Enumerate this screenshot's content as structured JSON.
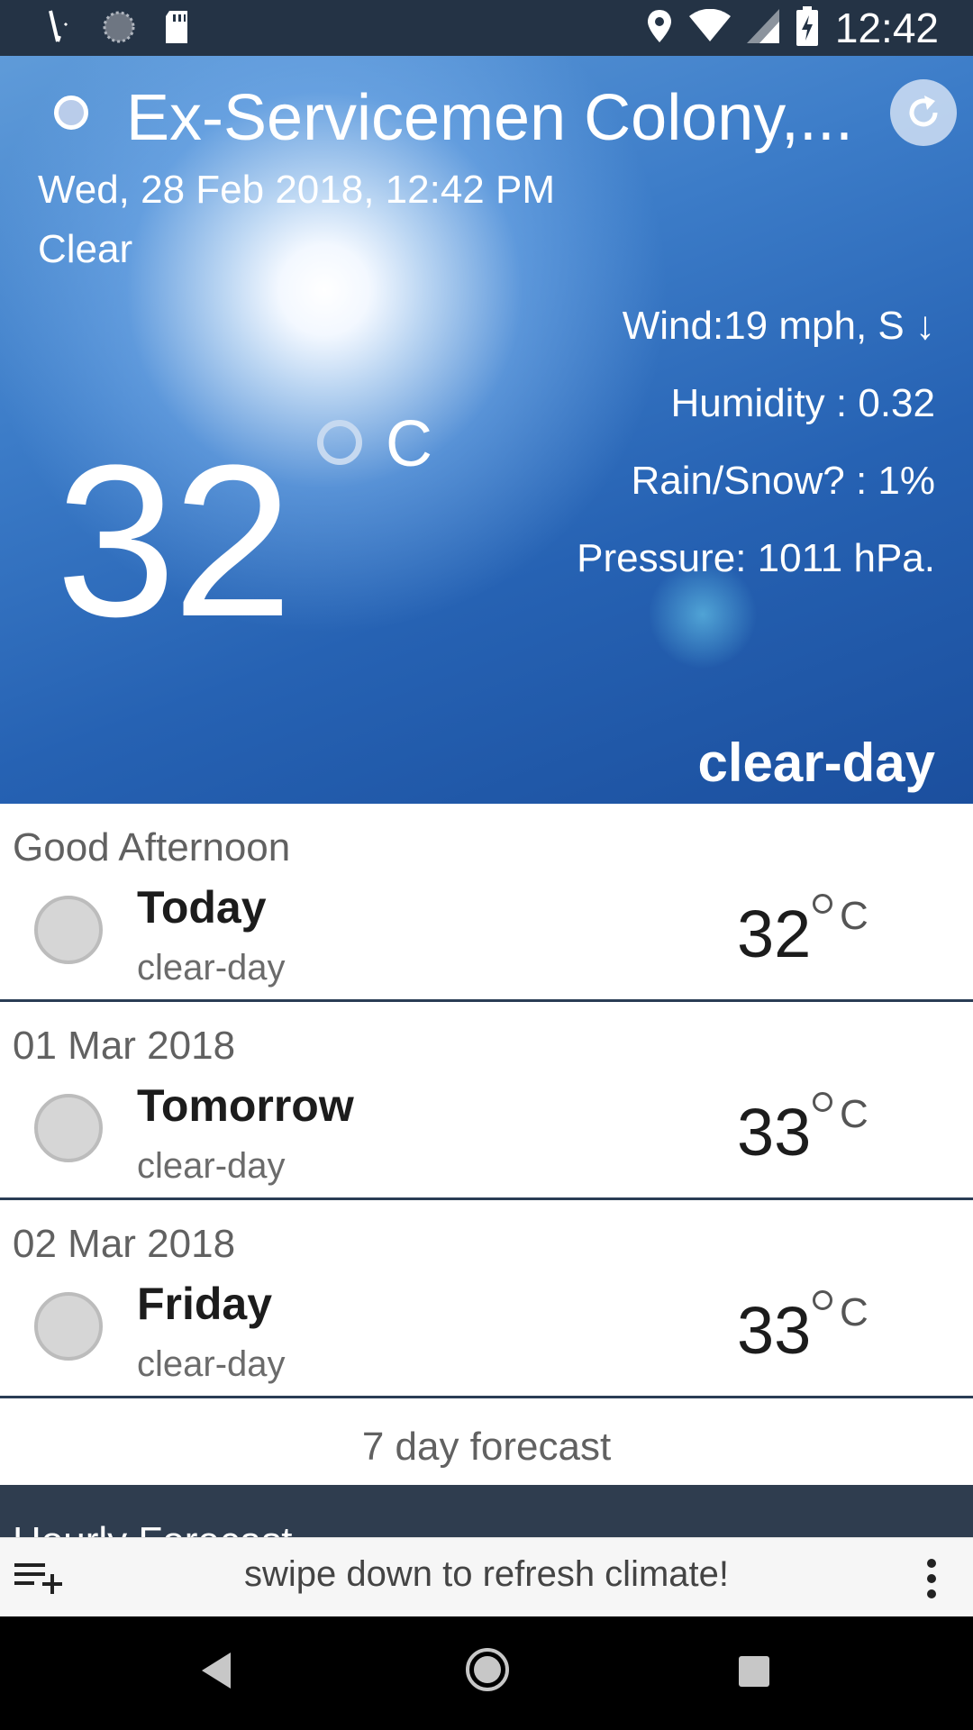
{
  "status_bar": {
    "time": "12:42",
    "left_icons": [
      "pen-icon",
      "sync-icon",
      "sd-card-icon"
    ],
    "right_icons": [
      "location-icon",
      "wifi-icon",
      "signal-icon",
      "battery-charging-icon"
    ]
  },
  "current": {
    "location": "Ex-Servicemen Colony,...",
    "datetime": "Wed, 28 Feb 2018, 12:42 PM",
    "summary": "Clear",
    "temperature": "32",
    "unit": "C",
    "wind": "Wind:19 mph, S ↓",
    "humidity": "Humidity : 0.32",
    "precip": "Rain/Snow? : 1%",
    "pressure": "Pressure: 1011 hPa.",
    "icon_label": "clear-day"
  },
  "forecast": [
    {
      "date": "Good Afternoon",
      "day": "Today",
      "condition": "clear-day",
      "temp": "32",
      "unit": "C"
    },
    {
      "date": "01 Mar 2018",
      "day": "Tomorrow",
      "condition": "clear-day",
      "temp": "33",
      "unit": "C"
    },
    {
      "date": "02 Mar 2018",
      "day": "Friday",
      "condition": "clear-day",
      "temp": "33",
      "unit": "C"
    }
  ],
  "seven_day_label": "7 day forecast",
  "hourly_label": "Hourly Forecast",
  "bottom_bar": {
    "hint": "swipe down to refresh climate!"
  },
  "colors": {
    "status_bar": "#243345",
    "divider": "#2a3d55",
    "hourly_header": "#2f3d4f"
  }
}
